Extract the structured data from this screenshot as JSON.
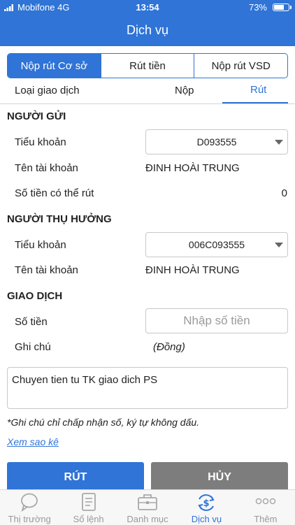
{
  "status_bar": {
    "carrier": "Mobifone  4G",
    "time": "13:54",
    "battery": "73%",
    "battery_level": 0.73
  },
  "header": {
    "title": "Dịch vụ"
  },
  "tabs": [
    {
      "label": "Nộp rút Cơ sở",
      "active": true
    },
    {
      "label": "Rút tiền",
      "active": false
    },
    {
      "label": "Nộp rút VSD",
      "active": false
    }
  ],
  "transaction_type": {
    "label": "Loại giao dịch",
    "options": [
      "Nộp",
      "Rút"
    ],
    "selected": "Rút"
  },
  "sender": {
    "heading": "NGƯỜI GỬI",
    "sub_account_label": "Tiểu khoản",
    "sub_account_value": "D093555",
    "account_name_label": "Tên tài khoản",
    "account_name_value": "ĐINH HOÀI TRUNG",
    "withdrawable_label": "Số tiền có thể rút",
    "withdrawable_value": "0"
  },
  "beneficiary": {
    "heading": "NGƯỜI THỤ HƯỞNG",
    "sub_account_label": "Tiểu khoản",
    "sub_account_value": "006C093555",
    "account_name_label": "Tên tài khoản",
    "account_name_value": "ĐINH HOÀI TRUNG"
  },
  "transaction": {
    "heading": "GIAO DỊCH",
    "amount_label": "Số tiền",
    "amount_placeholder": "Nhập số tiền",
    "note_label": "Ghi chú",
    "currency_hint": "(Đồng)",
    "note_value": "Chuyen tien tu TK giao dich PS",
    "note_hint": "*Ghi chú chỉ chấp nhận số, ký tự không dấu.",
    "statement_link": "Xem sao kê"
  },
  "buttons": {
    "withdraw": "RÚT",
    "cancel": "HỦY"
  },
  "bottom_nav": [
    {
      "label": "Thị trường",
      "icon": "chat-bubble-icon",
      "active": false
    },
    {
      "label": "Sổ lệnh",
      "icon": "order-book-icon",
      "active": false
    },
    {
      "label": "Danh mục",
      "icon": "briefcase-icon",
      "active": false
    },
    {
      "label": "Dịch vụ",
      "icon": "dollar-cycle-icon",
      "active": true
    },
    {
      "label": "Thêm",
      "icon": "more-dots-icon",
      "active": false
    }
  ],
  "colors": {
    "accent": "#2f74d6",
    "cancel": "#7d7d7d"
  }
}
